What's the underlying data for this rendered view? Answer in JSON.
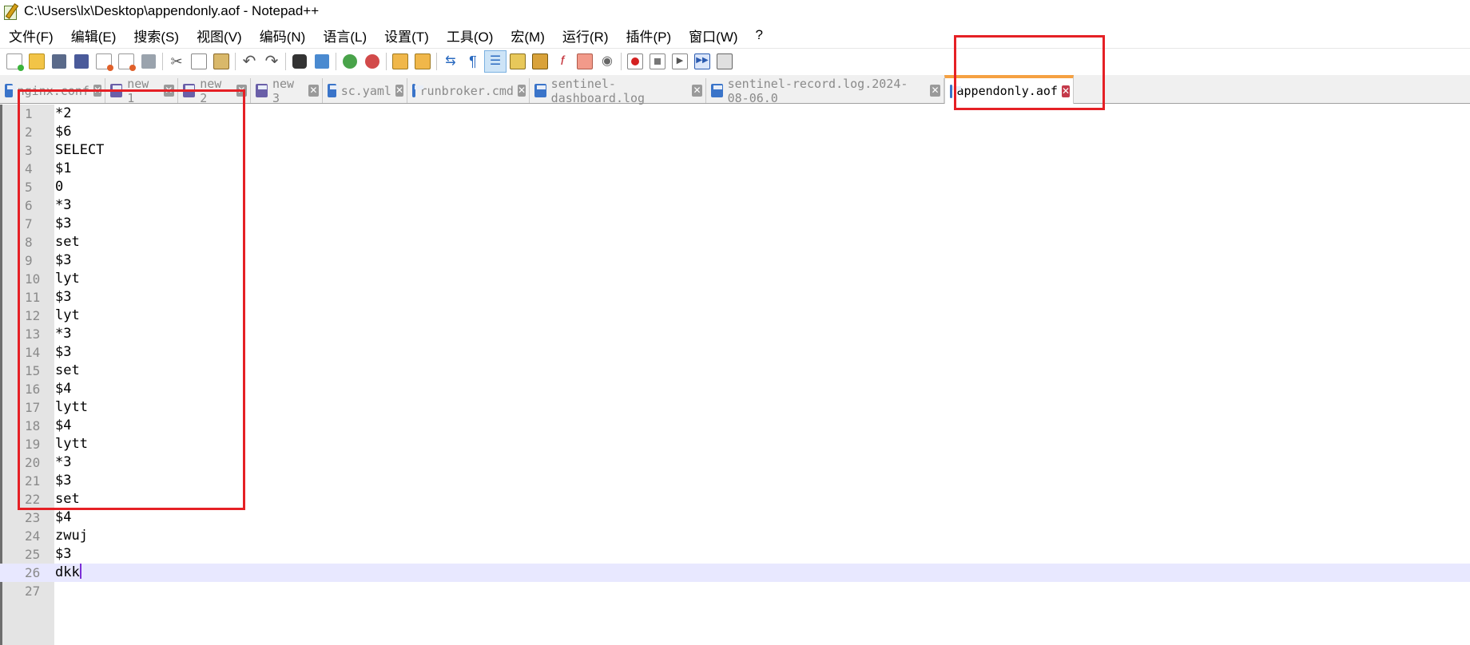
{
  "window": {
    "title": "C:\\Users\\lx\\Desktop\\appendonly.aof - Notepad++"
  },
  "menu": [
    "文件(F)",
    "编辑(E)",
    "搜索(S)",
    "视图(V)",
    "编码(N)",
    "语言(L)",
    "设置(T)",
    "工具(O)",
    "宏(M)",
    "运行(R)",
    "插件(P)",
    "窗口(W)",
    "?"
  ],
  "tabs": [
    {
      "label": "nginx.conf",
      "icon": "disk-icon"
    },
    {
      "label": "new 1",
      "icon": "disk-icon"
    },
    {
      "label": "new 2",
      "icon": "disk-icon"
    },
    {
      "label": "new 3",
      "icon": "disk-icon"
    },
    {
      "label": "sc.yaml",
      "icon": "disk-icon"
    },
    {
      "label": "runbroker.cmd",
      "icon": "disk-icon"
    },
    {
      "label": "sentinel-dashboard.log",
      "icon": "disk-icon"
    },
    {
      "label": "sentinel-record.log.2024-08-06.0",
      "icon": "disk-icon"
    },
    {
      "label": "appendonly.aof",
      "icon": "disk-icon",
      "active": true
    }
  ],
  "editor": {
    "lines": [
      "*2",
      "$6",
      "SELECT",
      "$1",
      "0",
      "*3",
      "$3",
      "set",
      "$3",
      "lyt",
      "$3",
      "lyt",
      "*3",
      "$3",
      "set",
      "$4",
      "lytt",
      "$4",
      "lytt",
      "*3",
      "$3",
      "set",
      "$4",
      "zwuj",
      "$3",
      "dkk",
      ""
    ],
    "current_line": 26
  },
  "colors": {
    "annotation": "#e52025",
    "tab_accent": "#f5a142",
    "current_line": "#e8e8ff"
  }
}
